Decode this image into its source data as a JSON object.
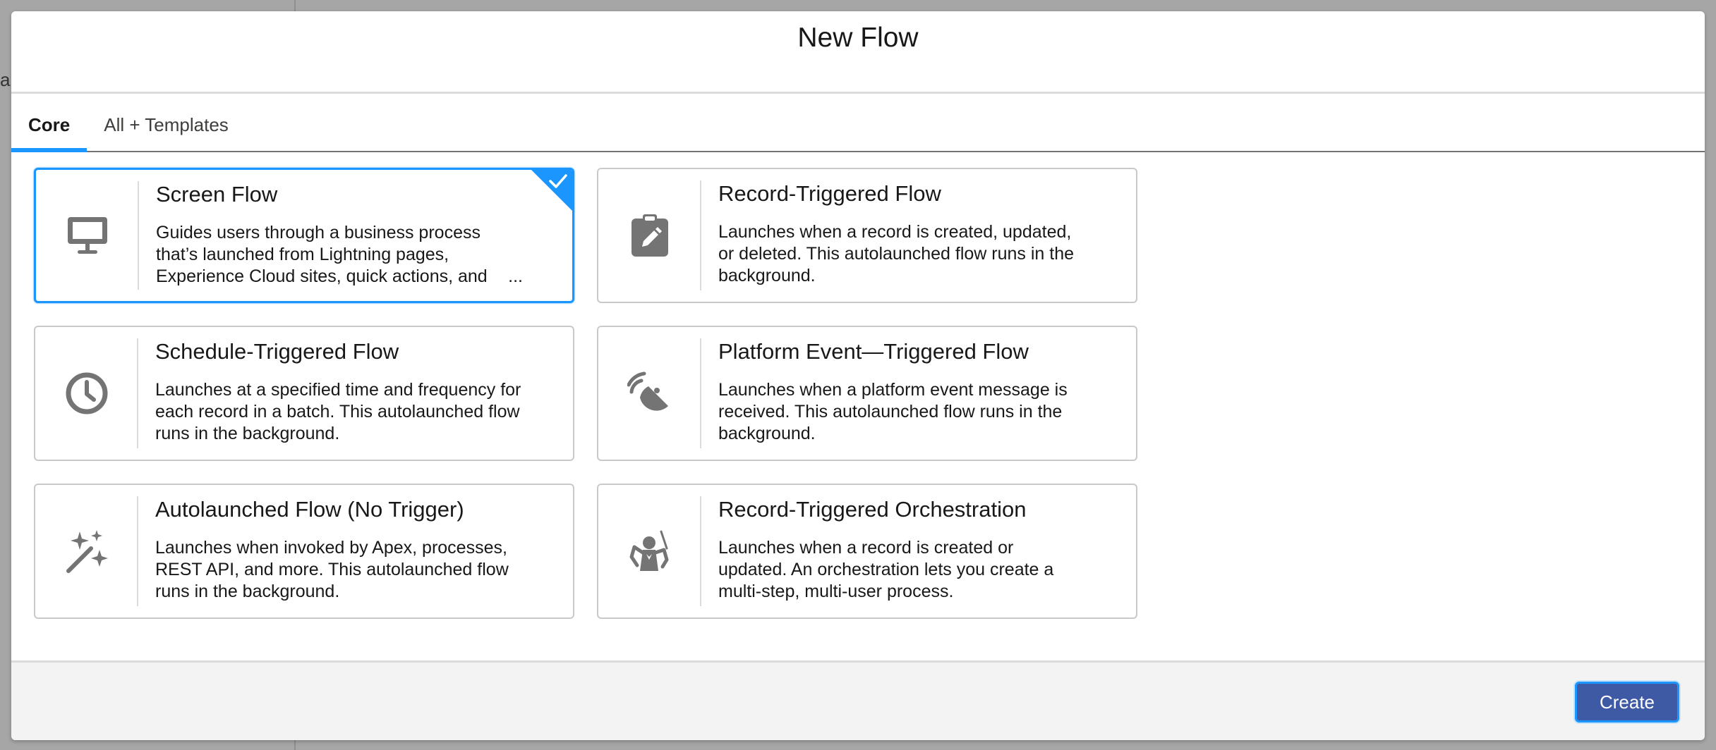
{
  "backdrop": {
    "fragment_text": "ar"
  },
  "modal": {
    "title": "New Flow",
    "tabs": [
      {
        "label": "Core",
        "active": true
      },
      {
        "label": "All + Templates",
        "active": false
      }
    ],
    "cards": [
      {
        "title": "Screen Flow",
        "description": "Guides users through a business process that’s launched from Lightning pages, Experience Cloud sites, quick actions, and",
        "ellipsis": "...",
        "icon": "monitor-icon",
        "selected": true
      },
      {
        "title": "Record-Triggered Flow",
        "description": "Launches when a record is created, updated, or deleted. This autolaunched flow runs in the background.",
        "icon": "clipboard-edit-icon",
        "selected": false
      },
      {
        "title": "Schedule-Triggered Flow",
        "description": "Launches at a specified time and frequency for each record in a batch. This autolaunched flow runs in the background.",
        "icon": "clock-icon",
        "selected": false
      },
      {
        "title": "Platform Event—Triggered Flow",
        "description": "Launches when a platform event message is received. This autolaunched flow runs in the background.",
        "icon": "broadcast-dish-icon",
        "selected": false
      },
      {
        "title": "Autolaunched Flow (No Trigger)",
        "description": "Launches when invoked by Apex, processes, REST API, and more. This autolaunched flow runs in the background.",
        "icon": "magic-wand-icon",
        "selected": false
      },
      {
        "title": "Record-Triggered Orchestration",
        "description": "Launches when a record is created or updated. An orchestration lets you create a multi-step, multi-user process.",
        "icon": "conductor-icon",
        "selected": false
      }
    ],
    "footer": {
      "create_label": "Create"
    }
  },
  "colors": {
    "brand_blue": "#1b96ff",
    "button_blue": "#3f5aa5",
    "icon_gray": "#747474",
    "border_gray": "#c9c9c9"
  }
}
